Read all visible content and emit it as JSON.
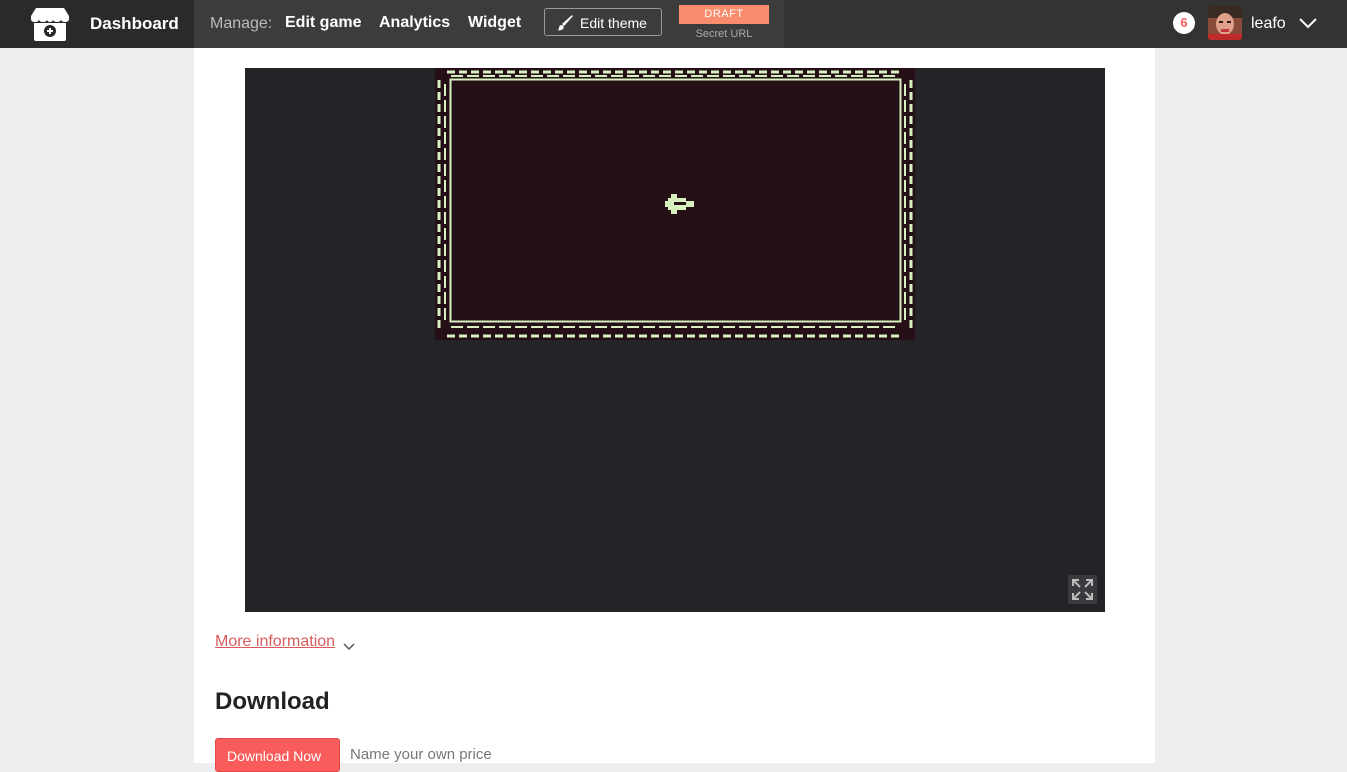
{
  "header": {
    "dashboard_label": "Dashboard",
    "manage_label": "Manage:",
    "nav": {
      "edit_game": "Edit game",
      "analytics": "Analytics",
      "widget": "Widget"
    },
    "edit_theme_label": "Edit theme",
    "draft_badge": "DRAFT",
    "secret_url_label": "Secret URL",
    "notification_count": "6",
    "username": "leafo"
  },
  "game": {
    "fullscreen_icon": "fullscreen-icon",
    "player_sprite_color": "#d8f0c0",
    "canvas_bg": "#241016"
  },
  "info": {
    "more_information": "More information"
  },
  "download": {
    "heading": "Download",
    "button_label": "Download Now",
    "price_note": "Name your own price"
  },
  "colors": {
    "accent": "#fa5c5c",
    "draft": "#fa8c6e",
    "header_bg": "#333333"
  }
}
